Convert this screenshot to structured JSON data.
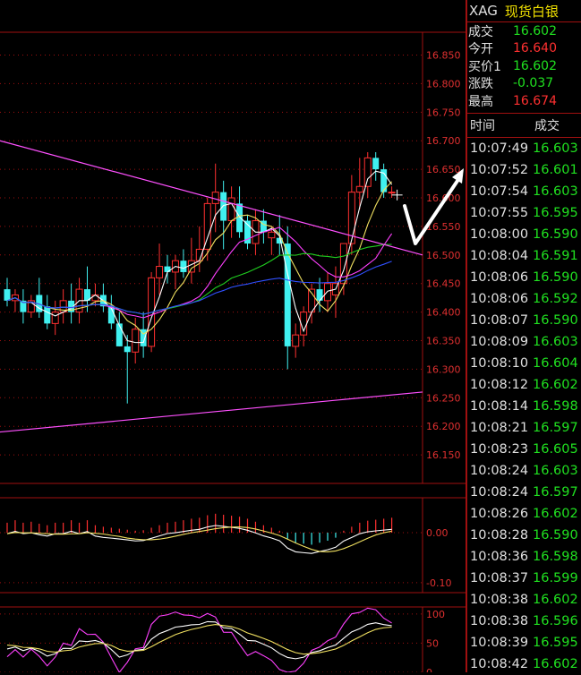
{
  "instrument": {
    "code": "XAG",
    "name": "现货白银"
  },
  "quote": [
    {
      "label": "成交",
      "value": "16.602",
      "color": "down"
    },
    {
      "label": "今开",
      "value": "16.640",
      "color": "up"
    },
    {
      "label": "买价1",
      "value": "16.602",
      "color": "down"
    },
    {
      "label": "涨跌",
      "value": "-0.037",
      "color": "down"
    },
    {
      "label": "最高",
      "value": "16.674",
      "color": "up"
    }
  ],
  "trades_header": {
    "time": "时间",
    "price": "成交"
  },
  "trades": [
    {
      "time": "10:07:49",
      "price": "16.603"
    },
    {
      "time": "10:07:52",
      "price": "16.601"
    },
    {
      "time": "10:07:54",
      "price": "16.603"
    },
    {
      "time": "10:07:55",
      "price": "16.595"
    },
    {
      "time": "10:08:00",
      "price": "16.590"
    },
    {
      "time": "10:08:04",
      "price": "16.591"
    },
    {
      "time": "10:08:06",
      "price": "16.590"
    },
    {
      "time": "10:08:06",
      "price": "16.592"
    },
    {
      "time": "10:08:07",
      "price": "16.590"
    },
    {
      "time": "10:08:09",
      "price": "16.603"
    },
    {
      "time": "10:08:10",
      "price": "16.604"
    },
    {
      "time": "10:08:12",
      "price": "16.602"
    },
    {
      "time": "10:08:14",
      "price": "16.598"
    },
    {
      "time": "10:08:21",
      "price": "16.597"
    },
    {
      "time": "10:08:23",
      "price": "16.605"
    },
    {
      "time": "10:08:24",
      "price": "16.603"
    },
    {
      "time": "10:08:24",
      "price": "16.597"
    },
    {
      "time": "10:08:26",
      "price": "16.602"
    },
    {
      "time": "10:08:28",
      "price": "16.590"
    },
    {
      "time": "10:08:36",
      "price": "16.598"
    },
    {
      "time": "10:08:37",
      "price": "16.599"
    },
    {
      "time": "10:08:38",
      "price": "16.602"
    },
    {
      "time": "10:08:38",
      "price": "16.596"
    },
    {
      "time": "10:08:39",
      "price": "16.595"
    },
    {
      "time": "10:08:42",
      "price": "16.602"
    }
  ],
  "colors": {
    "up": "#ff3030",
    "down": "#20e020",
    "bull_candle": "#ff3030",
    "bear_candle": "#40f0f0",
    "grid": "#a01010",
    "axis_text": "#e03030"
  },
  "chart_data": [
    {
      "type": "candlestick",
      "ylim": [
        16.1,
        16.89
      ],
      "yticks": [
        "16.850",
        "16.800",
        "16.750",
        "16.700",
        "16.650",
        "16.600",
        "16.550",
        "16.500",
        "16.450",
        "16.400",
        "16.350",
        "16.300",
        "16.250",
        "16.200",
        "16.150"
      ],
      "candles": [
        [
          16.44,
          16.46,
          16.41,
          16.42
        ],
        [
          16.42,
          16.44,
          16.4,
          16.43
        ],
        [
          16.42,
          16.44,
          16.38,
          16.4
        ],
        [
          16.4,
          16.43,
          16.39,
          16.42
        ],
        [
          16.43,
          16.46,
          16.39,
          16.4
        ],
        [
          16.41,
          16.43,
          16.37,
          16.38
        ],
        [
          16.38,
          16.42,
          16.36,
          16.4
        ],
        [
          16.4,
          16.44,
          16.38,
          16.42
        ],
        [
          16.42,
          16.45,
          16.38,
          16.4
        ],
        [
          16.4,
          16.46,
          16.38,
          16.44
        ],
        [
          16.44,
          16.48,
          16.4,
          16.42
        ],
        [
          16.42,
          16.45,
          16.41,
          16.43
        ],
        [
          16.43,
          16.45,
          16.4,
          16.41
        ],
        [
          16.41,
          16.43,
          16.37,
          16.38
        ],
        [
          16.38,
          16.4,
          16.34,
          16.34
        ],
        [
          16.34,
          16.36,
          16.24,
          16.33
        ],
        [
          16.33,
          16.39,
          16.31,
          16.37
        ],
        [
          16.37,
          16.4,
          16.32,
          16.34
        ],
        [
          16.34,
          16.47,
          16.33,
          16.46
        ],
        [
          16.46,
          16.52,
          16.43,
          16.48
        ],
        [
          16.48,
          16.5,
          16.45,
          16.47
        ],
        [
          16.47,
          16.5,
          16.44,
          16.49
        ],
        [
          16.49,
          16.51,
          16.46,
          16.47
        ],
        [
          16.47,
          16.53,
          16.45,
          16.49
        ],
        [
          16.49,
          16.55,
          16.47,
          16.51
        ],
        [
          16.51,
          16.6,
          16.49,
          16.59
        ],
        [
          16.59,
          16.66,
          16.54,
          16.61
        ],
        [
          16.61,
          16.63,
          16.51,
          16.56
        ],
        [
          16.56,
          16.62,
          16.53,
          16.6
        ],
        [
          16.59,
          16.62,
          16.53,
          16.54
        ],
        [
          16.56,
          16.57,
          16.51,
          16.52
        ],
        [
          16.52,
          16.58,
          16.5,
          16.56
        ],
        [
          16.56,
          16.58,
          16.52,
          16.54
        ],
        [
          16.53,
          16.55,
          16.5,
          16.54
        ],
        [
          16.53,
          16.57,
          16.5,
          16.52
        ],
        [
          16.52,
          16.55,
          16.3,
          16.34
        ],
        [
          16.34,
          16.38,
          16.32,
          16.36
        ],
        [
          16.36,
          16.41,
          16.34,
          16.4
        ],
        [
          16.4,
          16.45,
          16.38,
          16.44
        ],
        [
          16.44,
          16.46,
          16.4,
          16.42
        ],
        [
          16.42,
          16.47,
          16.4,
          16.45
        ],
        [
          16.43,
          16.48,
          16.39,
          16.45
        ],
        [
          16.45,
          16.52,
          16.43,
          16.52
        ],
        [
          16.52,
          16.64,
          16.5,
          16.61
        ],
        [
          16.61,
          16.67,
          16.58,
          16.62
        ],
        [
          16.62,
          16.68,
          16.6,
          16.67
        ],
        [
          16.67,
          16.68,
          16.63,
          16.65
        ],
        [
          16.65,
          16.66,
          16.6,
          16.61
        ],
        [
          16.61,
          16.62,
          16.6,
          16.61
        ]
      ]
    },
    {
      "type": "bar",
      "ylim": [
        -0.12,
        0.07
      ],
      "yticks": [
        "0.00",
        "-0.10"
      ],
      "values": [
        0.02,
        0.025,
        0.02,
        0.022,
        0.018,
        0.015,
        0.02,
        0.02,
        0.025,
        0.02,
        0.025,
        0.015,
        0.012,
        0.01,
        0.008,
        0.006,
        0.004,
        0.005,
        0.01,
        0.015,
        0.02,
        0.022,
        0.025,
        0.028,
        0.03,
        0.035,
        0.038,
        0.036,
        0.034,
        0.032,
        0.028,
        0.022,
        0.015,
        0.01,
        0.004,
        -0.012,
        -0.02,
        -0.022,
        -0.024,
        -0.02,
        -0.016,
        -0.01,
        0.004,
        0.012,
        0.02,
        0.024,
        0.026,
        0.028,
        0.03
      ]
    },
    {
      "type": "line",
      "ylim": [
        0,
        112
      ],
      "yticks": [
        "100",
        "50",
        "0"
      ]
    }
  ]
}
